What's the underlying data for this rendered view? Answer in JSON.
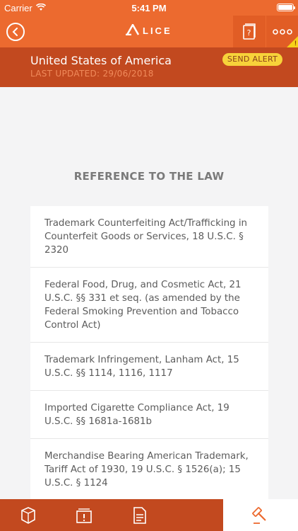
{
  "status_bar": {
    "carrier": "Carrier",
    "time": "5:41 PM",
    "battery_level": 1.0
  },
  "nav": {
    "logo_text": "LICE",
    "logo_mark": "A",
    "warning_mark": "!"
  },
  "header": {
    "country": "United States of America",
    "last_updated": "LAST UPDATED: 29/06/2018",
    "send_alert_label": "SEND ALERT"
  },
  "section_title": "REFERENCE TO THE LAW",
  "laws": [
    "Trademark Counterfeiting Act/Trafficking in Counterfeit Goods or Services, 18 U.S.C. § 2320",
    "Federal Food, Drug, and Cosmetic Act, 21 U.S.C. §§ 331 et seq. (as amended by the Federal Smoking Prevention and Tobacco Control Act)",
    "Trademark Infringement, Lanham Act, 15 U.S.C. §§ 1114, 1116, 1117",
    "Imported Cigarette Compliance Act, 19 U.S.C. §§ 1681a-1681b",
    "Merchandise Bearing American Trademark, Tariff Act of 1930, 19 U.S.C. § 1526(a); 15 U.S.C. § 1124",
    ""
  ],
  "tabs": [
    {
      "icon": "box-icon",
      "active": false
    },
    {
      "icon": "alert-card-icon",
      "active": false
    },
    {
      "icon": "document-icon",
      "active": false
    },
    {
      "icon": "gavel-icon",
      "active": true
    }
  ],
  "colors": {
    "primary": "#ec6a2f",
    "dark": "#c2491f",
    "accent": "#f7d33a",
    "background": "#f4f4f5"
  }
}
